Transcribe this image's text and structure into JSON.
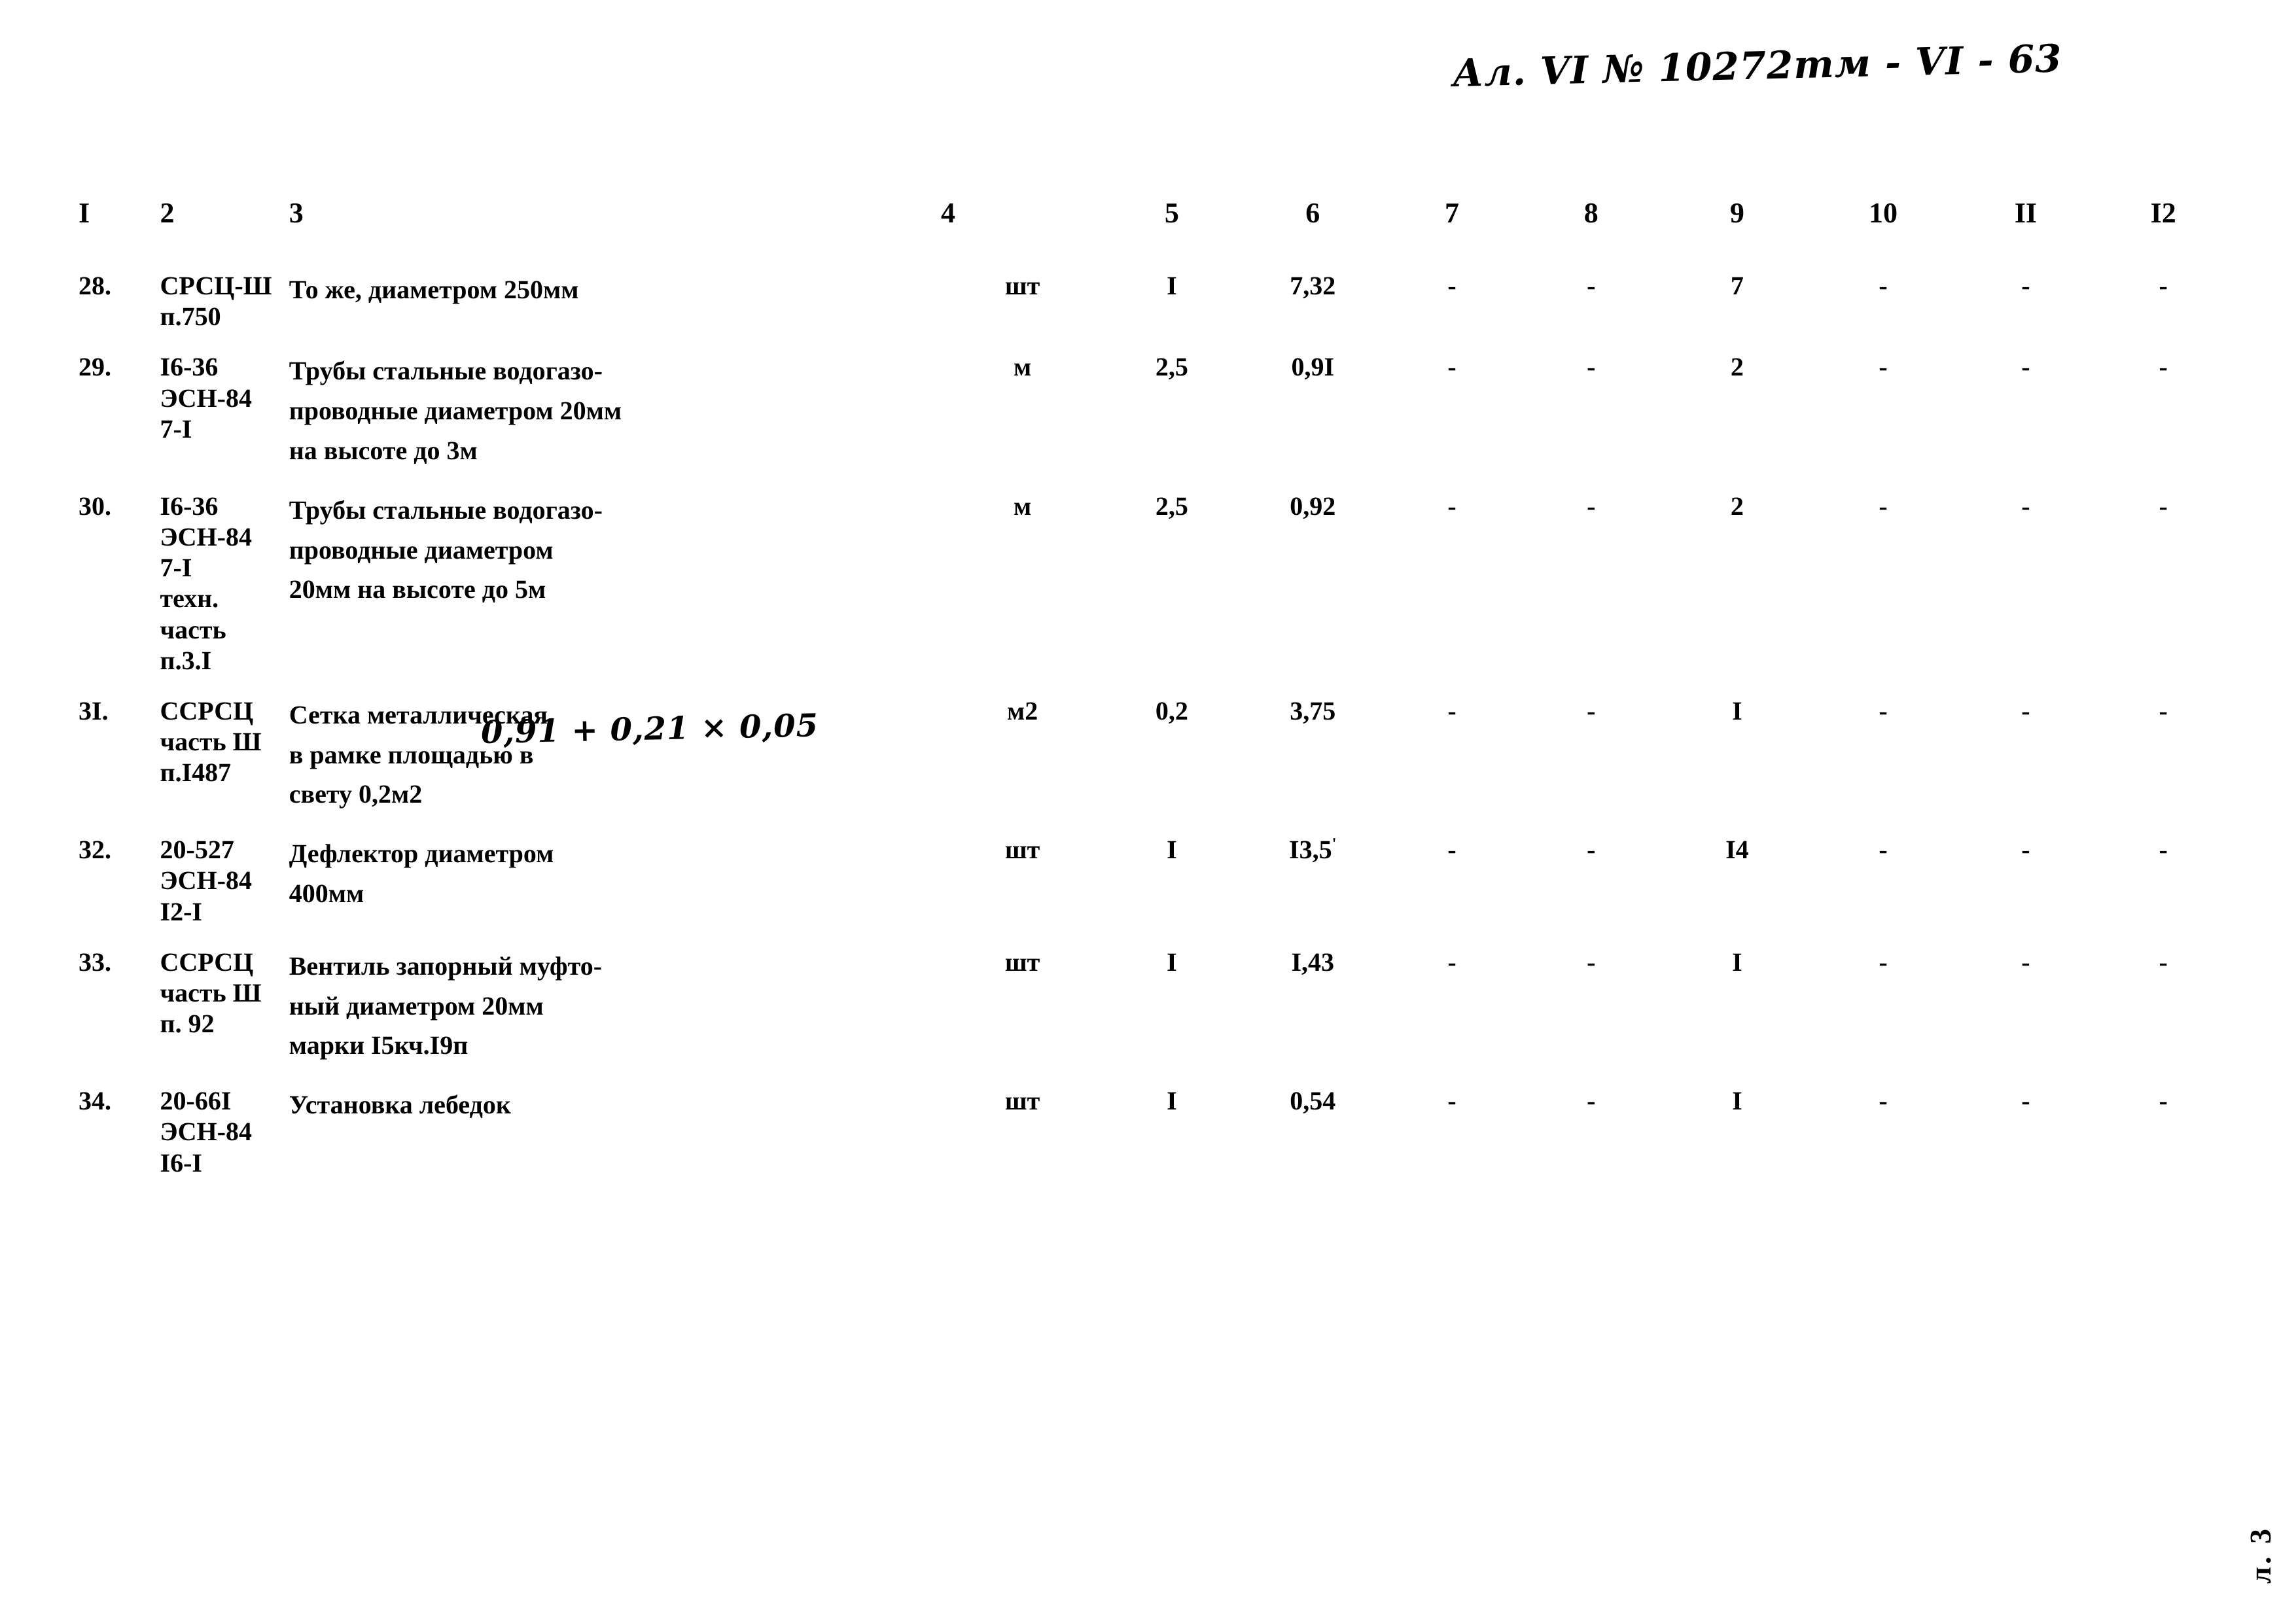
{
  "document": {
    "handwritten_header": "Ал. VI № 10272тм - VI - 63",
    "page_mark": "л. 3",
    "handwritten_formula": "0,91 + 0,21 × 0,05"
  },
  "table": {
    "column_numbers": [
      "I",
      "2",
      "3",
      "4",
      "5",
      "6",
      "7",
      "8",
      "9",
      "10",
      "II",
      "I2"
    ],
    "rows": [
      {
        "num": "28.",
        "code_lines": [
          "СРСЦ-Ш",
          "п.750"
        ],
        "desc_lines": [
          "То же, диаметром 250мм"
        ],
        "unit": "шт",
        "qty": "I",
        "c6": "7,32",
        "c7": "-",
        "c8": "-",
        "c9": "7",
        "c10": "-",
        "c11": "-",
        "c12": "-"
      },
      {
        "num": "29.",
        "code_lines": [
          "I6-36",
          "ЭСН-84",
          "7-I"
        ],
        "desc_lines": [
          "Трубы стальные водогазо-",
          "проводные диаметром 20мм",
          "на высоте до 3м"
        ],
        "unit": "м",
        "qty": "2,5",
        "c6": "0,9I",
        "c7": "-",
        "c8": "-",
        "c9": "2",
        "c10": "-",
        "c11": "-",
        "c12": "-"
      },
      {
        "num": "30.",
        "code_lines": [
          "I6-36",
          "ЭСН-84",
          "7-I",
          "техн.",
          "часть",
          "п.3.I"
        ],
        "desc_lines": [
          "Трубы стальные водогазо-",
          "проводные диаметром",
          "20мм на высоте до 5м"
        ],
        "unit": "м",
        "qty": "2,5",
        "c6": "0,92",
        "c7": "-",
        "c8": "-",
        "c9": "2",
        "c10": "-",
        "c11": "-",
        "c12": "-"
      },
      {
        "num": "3I.",
        "code_lines": [
          "ССРСЦ",
          "часть Ш",
          "п.I487"
        ],
        "desc_lines": [
          "Сетка металлическая",
          "в рамке площадью в",
          "свету 0,2м2"
        ],
        "unit": "м2",
        "qty": "0,2",
        "c6": "3,75",
        "c7": "-",
        "c8": "-",
        "c9": "I",
        "c10": "-",
        "c11": "-",
        "c12": "-"
      },
      {
        "num": "32.",
        "code_lines": [
          "20-527",
          "ЭСН-84",
          "I2-I"
        ],
        "desc_lines": [
          "Дефлектор диаметром",
          "400мм"
        ],
        "unit": "шт",
        "qty": "I",
        "c6": "I3,5",
        "c6_sup": "'",
        "c7": "-",
        "c8": "-",
        "c9": "I4",
        "c10": "-",
        "c11": "-",
        "c12": "-"
      },
      {
        "num": "33.",
        "code_lines": [
          "ССРСЦ",
          "часть Ш",
          "п. 92"
        ],
        "desc_lines": [
          "Вентиль запорный муфто-",
          "ный диаметром 20мм",
          "марки I5кч.I9п"
        ],
        "unit": "шт",
        "qty": "I",
        "c6": "I,43",
        "c7": "-",
        "c8": "-",
        "c9": "I",
        "c10": "-",
        "c11": "-",
        "c12": "-"
      },
      {
        "num": "34.",
        "code_lines": [
          "20-66I",
          "ЭСН-84",
          "I6-I"
        ],
        "desc_lines": [
          "Установка лебедок"
        ],
        "unit": "шт",
        "qty": "I",
        "c6": "0,54",
        "c7": "-",
        "c8": "-",
        "c9": "I",
        "c10": "-",
        "c11": "-",
        "c12": "-"
      }
    ]
  }
}
